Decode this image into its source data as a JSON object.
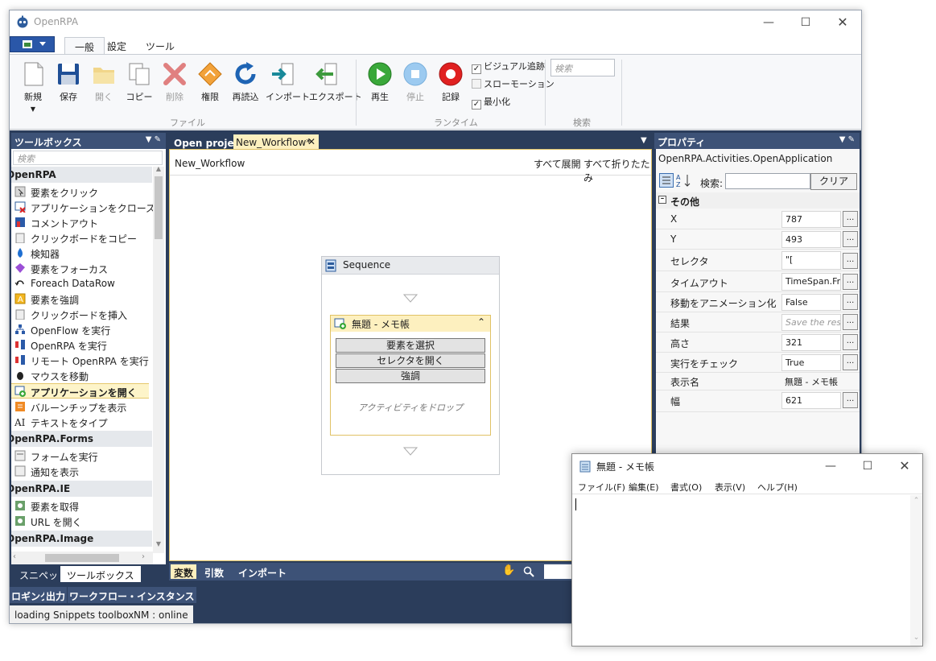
{
  "app": {
    "title": "OpenRPA"
  },
  "ribbon": {
    "tabs": [
      "一般",
      "設定",
      "ツール"
    ],
    "buttons": {
      "new": "新規",
      "save": "保存",
      "open": "開く",
      "copy": "コピー",
      "delete": "削除",
      "permission": "権限",
      "reload": "再読込",
      "import": "インポート",
      "export": "エクスポート",
      "play": "再生",
      "stop": "停止",
      "record": "記録"
    },
    "checks": {
      "visual_tracking": "ビジュアル追跡",
      "slow_motion": "スローモーション",
      "minimize": "最小化"
    },
    "search_placeholder": "検索",
    "groups": {
      "file": "ファイル",
      "runtime": "ランタイム",
      "search": "検索"
    }
  },
  "toolbox": {
    "title": "ツールボックス",
    "search_placeholder": "検索",
    "categories": {
      "openrpa": "OpenRPA",
      "forms": "OpenRPA.Forms",
      "ie": "OpenRPA.IE",
      "image": "OpenRPA.Image"
    },
    "items": [
      "要素をクリック",
      "アプリケーションをクローズ",
      "コメントアウト",
      "クリックボードをコピー",
      "検知器",
      "要素をフォーカス",
      "Foreach DataRow",
      "要素を強調",
      "クリックボードを挿入",
      "OpenFlow を実行",
      "OpenRPA を実行",
      "リモート OpenRPA を実行",
      "マウスを移動",
      "アプリケーションを開く",
      "バルーンチップを表示",
      "テキストをタイプ"
    ],
    "forms_items": [
      "フォームを実行",
      "通知を表示"
    ],
    "ie_items": [
      "要素を取得",
      "URL を開く"
    ],
    "bottom_tabs": [
      "スニペット",
      "ツールボックス"
    ]
  },
  "document": {
    "tabs": [
      "Open project",
      "New_Workflow*"
    ],
    "breadcrumb": "New_Workflow",
    "expand_all": "すべて展開",
    "collapse_all": "すべて折りたたみ",
    "sequence_title": "Sequence",
    "activity_title": "無題 - メモ帳",
    "activity_buttons": [
      "要素を選択",
      "セレクタを開く",
      "強調"
    ],
    "drop_hint": "アクティビティをドロップ",
    "bottom_tabs": [
      "変数",
      "引数",
      "インポート"
    ]
  },
  "properties": {
    "title": "プロパティ",
    "type_name": "OpenRPA.Activities.OpenApplication",
    "search_label": "検索:",
    "clear_label": "クリア",
    "section": "その他",
    "rows": [
      {
        "name": "X",
        "value": "787",
        "btn": "..."
      },
      {
        "name": "Y",
        "value": "493",
        "btn": "..."
      },
      {
        "name": "セレクタ",
        "value": "\"[",
        "btn": "..."
      },
      {
        "name": "タイムアウト",
        "value": "TimeSpan.Fr",
        "btn": "..."
      },
      {
        "name": "移動をアニメーション化",
        "value": "False",
        "btn": "..."
      },
      {
        "name": "結果",
        "value": "Save the res",
        "btn": "..."
      },
      {
        "name": "高さ",
        "value": "321",
        "btn": "..."
      },
      {
        "name": "実行をチェック",
        "value": "True",
        "btn": "..."
      },
      {
        "name": "表示名",
        "value": "無題 - メモ帳",
        "btn": ""
      },
      {
        "name": "幅",
        "value": "621",
        "btn": "..."
      }
    ]
  },
  "bottom": {
    "tabs": [
      "ロギング",
      "出力",
      "ワークフロー・インスタンス"
    ],
    "status_text": "loading Snippets toolbox",
    "nm_status": "NM : online"
  },
  "notepad": {
    "title": "無題 - メモ帳",
    "menu": [
      "ファイル(F)",
      "編集(E)",
      "書式(O)",
      "表示(V)",
      "ヘルプ(H)"
    ]
  }
}
